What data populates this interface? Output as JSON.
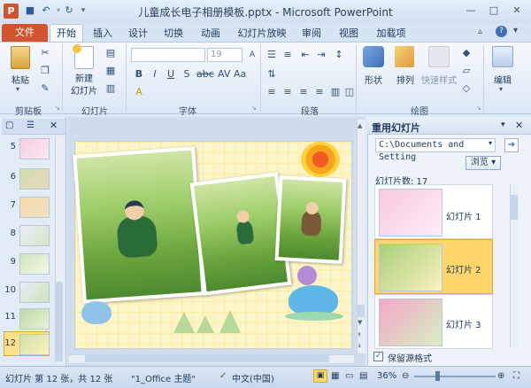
{
  "window": {
    "title": "儿童成长电子相册模板.pptx - Microsoft PowerPoint"
  },
  "tabs": {
    "file": "文件",
    "home": "开始",
    "insert": "插入",
    "design": "设计",
    "transitions": "切换",
    "animations": "动画",
    "slideshow": "幻灯片放映",
    "review": "审阅",
    "view": "视图",
    "addins": "加载项"
  },
  "ribbon": {
    "clipboard": {
      "label": "剪贴板",
      "paste": "粘贴"
    },
    "slides": {
      "label": "幻灯片",
      "new_slide_1": "新建",
      "new_slide_2": "幻灯片"
    },
    "font": {
      "label": "字体",
      "size": "19"
    },
    "paragraph": {
      "label": "段落"
    },
    "drawing": {
      "label": "绘图",
      "shape": "形状",
      "arrange": "排列",
      "quick_styles": "快速样式"
    },
    "editing": {
      "label": "编辑"
    }
  },
  "thumbs": {
    "n5": "5",
    "n6": "6",
    "n7": "7",
    "n8": "8",
    "n9": "9",
    "n10": "10",
    "n11": "11",
    "n12": "12"
  },
  "reuse": {
    "title": "重用幻灯片",
    "path": "C:\\Documents and Setting",
    "browse": "浏览",
    "count": "幻灯片数: 17",
    "s1": "幻灯片 1",
    "s2": "幻灯片 2",
    "s3": "幻灯片 3",
    "keep_format": "保留源格式"
  },
  "status": {
    "slide": "幻灯片 第 12 张，共 12 张",
    "theme": "\"1_Office 主题\"",
    "lang": "中文(中国)",
    "zoom": "36%"
  },
  "colors": {
    "file_tab": "#d2542c",
    "selection": "#ffd66b"
  }
}
